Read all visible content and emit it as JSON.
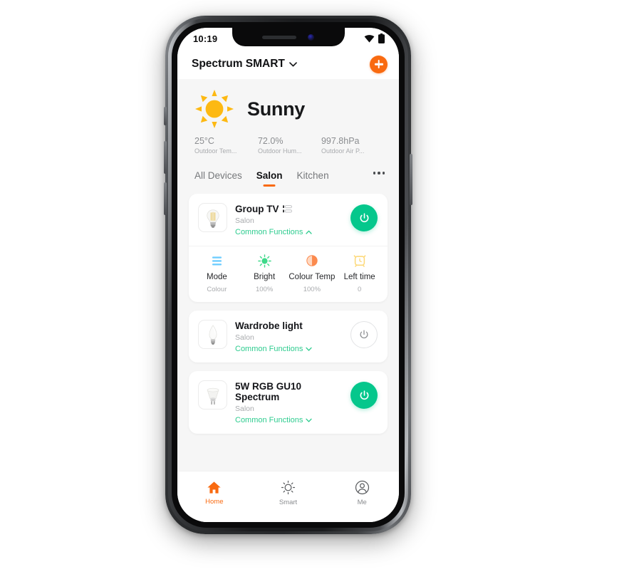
{
  "status_bar": {
    "time": "10:19",
    "wifi_icon": "wifi-icon",
    "battery_icon": "battery-icon"
  },
  "app_header": {
    "home_name": "Spectrum SMART",
    "chevron_icon": "chevron-down-icon",
    "add_icon": "plus-icon"
  },
  "weather": {
    "icon": "sun-icon",
    "condition": "Sunny",
    "stats": [
      {
        "value": "25°C",
        "label": "Outdoor Tem..."
      },
      {
        "value": "72.0%",
        "label": "Outdoor Hum..."
      },
      {
        "value": "997.8hPa",
        "label": "Outdoor Air P..."
      }
    ]
  },
  "tabs": {
    "items": [
      {
        "label": "All Devices",
        "active": false
      },
      {
        "label": "Salon",
        "active": true
      },
      {
        "label": "Kitchen",
        "active": false
      }
    ],
    "more_icon": "more-horizontal-icon"
  },
  "devices": [
    {
      "name": "Group TV",
      "is_group": true,
      "group_icon": "group-stack-icon",
      "room": "Salon",
      "functions_label": "Common Functions",
      "functions_chevron": "chevron-up-icon",
      "expanded": true,
      "power": "on",
      "thumb_icon": "filament-bulb-icon",
      "functions": [
        {
          "icon": "mode-lines-icon",
          "label": "Mode",
          "value": "Colour"
        },
        {
          "icon": "brightness-icon",
          "label": "Bright",
          "value": "100%"
        },
        {
          "icon": "colour-temp-icon",
          "label": "Colour Temp",
          "value": "100%"
        },
        {
          "icon": "alarm-clock-icon",
          "label": "Left time",
          "value": "0"
        }
      ]
    },
    {
      "name": "Wardrobe light",
      "is_group": false,
      "room": "Salon",
      "functions_label": "Common Functions",
      "functions_chevron": "chevron-down-icon",
      "expanded": false,
      "power": "off",
      "thumb_icon": "candle-bulb-icon",
      "functions": []
    },
    {
      "name": "5W RGB GU10 Spectrum",
      "is_group": false,
      "room": "Salon",
      "functions_label": "Common Functions",
      "functions_chevron": "chevron-down-icon",
      "expanded": false,
      "power": "on",
      "thumb_icon": "gu10-spotlight-icon",
      "functions": []
    }
  ],
  "bottom_nav": [
    {
      "label": "Home",
      "icon": "home-icon",
      "active": true
    },
    {
      "label": "Smart",
      "icon": "smart-sun-icon",
      "active": false
    },
    {
      "label": "Me",
      "icon": "account-icon",
      "active": false
    }
  ],
  "colors": {
    "accent_orange": "#f96a10",
    "toggle_green": "#05c78c",
    "link_green": "#2ecc8f",
    "panel_grey": "#f6f6f6"
  }
}
